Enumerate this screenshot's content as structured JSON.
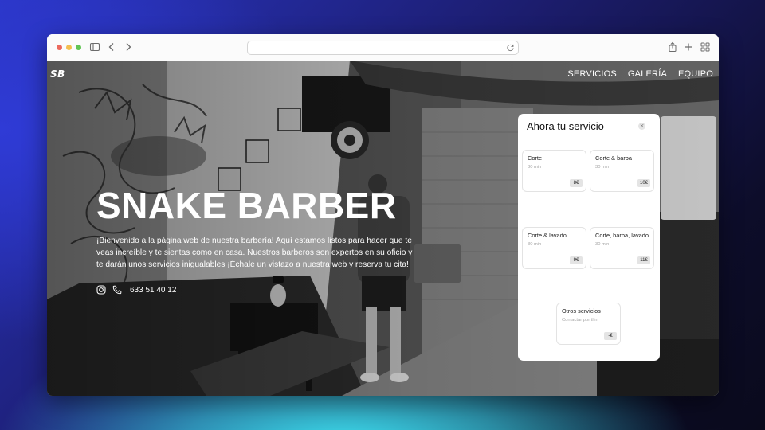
{
  "site": {
    "logo": "SB",
    "nav": [
      "SERVICIOS",
      "GALERÍA",
      "EQUIPO"
    ]
  },
  "hero": {
    "title": "SNAKE BARBER",
    "description": "¡Bienvenido a la página web de nuestra barbería! Aquí estamos listos para hacer que te veas increíble y te sientas como en casa. Nuestros barberos son expertos en su oficio y te darán unos servicios inigualables ¡Échale un vistazo a nuestra web y reserva tu cita!",
    "phone": "633 51 40 12"
  },
  "panel": {
    "title": "Ahora tu servicio",
    "close": "×",
    "services": [
      {
        "name": "Corte",
        "duration": "30 min",
        "price": "8€"
      },
      {
        "name": "Corte & barba",
        "duration": "30 min",
        "price": "10€"
      },
      {
        "name": "Corte & lavado",
        "duration": "30 min",
        "price": "9€"
      },
      {
        "name": "Corte, barba, lavado",
        "duration": "30 min",
        "price": "11€"
      },
      {
        "name": "Otros servicios",
        "duration": "Contactar por tlfn",
        "price": "-€"
      }
    ]
  },
  "colors": {
    "traffic_red": "#ec6a5e",
    "traffic_yellow": "#f4bf4f",
    "traffic_green": "#61c554",
    "price_badge": "#e4e4e4"
  },
  "icons": [
    "sidebar-icon",
    "back-icon",
    "forward-icon",
    "reload-icon",
    "share-icon",
    "new-tab-icon",
    "tab-overview-icon",
    "instagram-icon",
    "phone-icon",
    "close-icon"
  ]
}
